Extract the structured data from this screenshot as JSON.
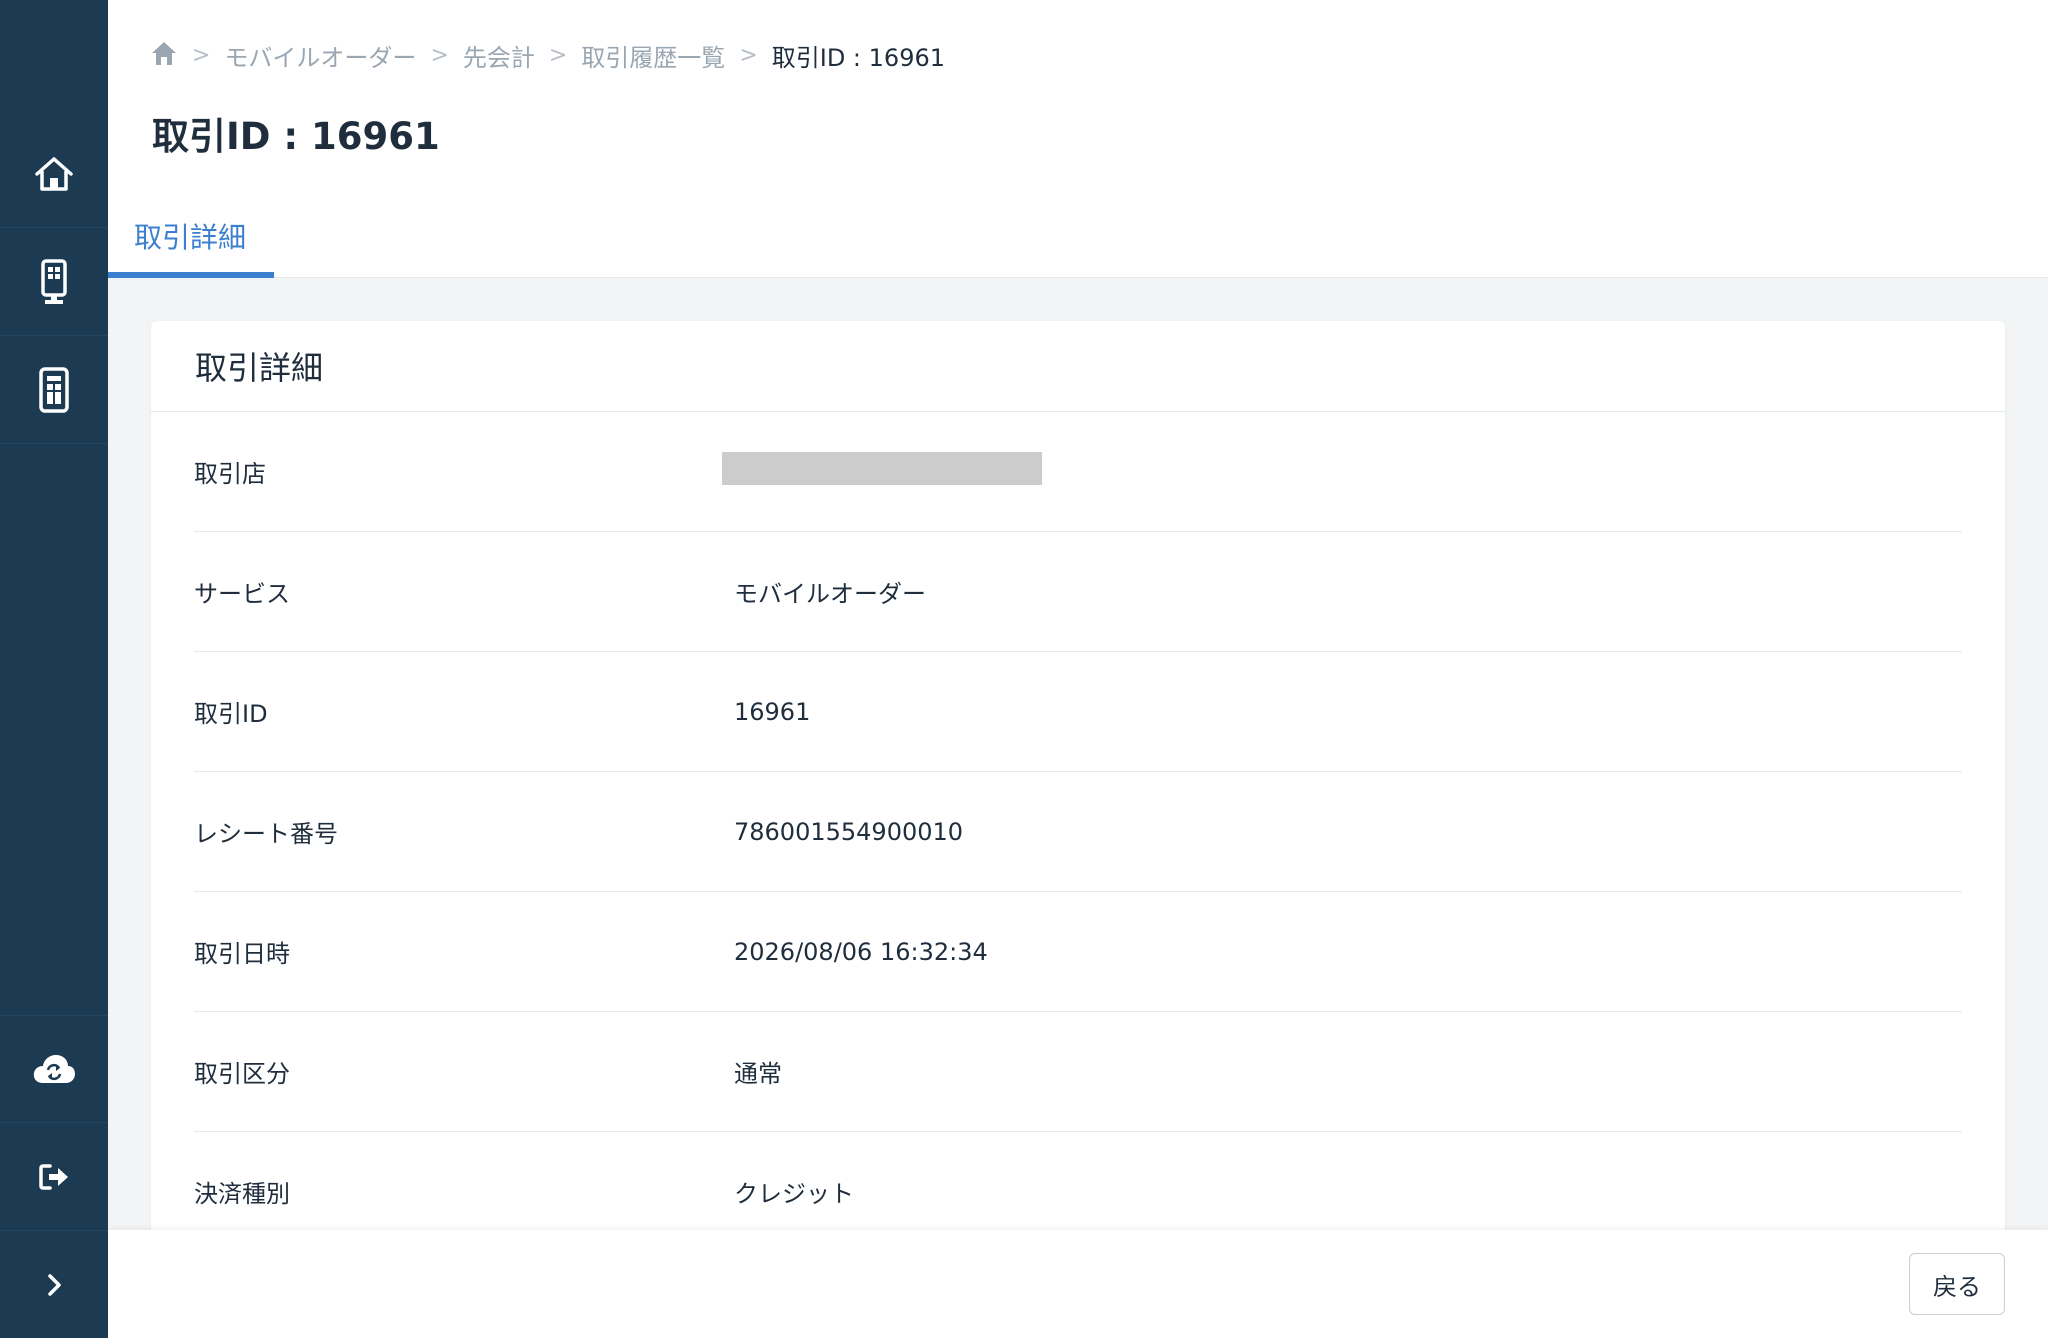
{
  "breadcrumb": {
    "items": [
      "モバイルオーダー",
      "先会計",
      "取引履歴一覧"
    ],
    "current": "取引ID : 16961"
  },
  "page_title": "取引ID : 16961",
  "tab": {
    "label": "取引詳細"
  },
  "card": {
    "title": "取引詳細",
    "rows": [
      {
        "label": "取引店",
        "value": ""
      },
      {
        "label": "サービス",
        "value": "モバイルオーダー"
      },
      {
        "label": "取引ID",
        "value": "16961"
      },
      {
        "label": "レシート番号",
        "value": "786001554900010"
      },
      {
        "label": "取引日時",
        "value": "2026/08/06 16:32:34"
      },
      {
        "label": "取引区分",
        "value": "通常"
      },
      {
        "label": "決済種別",
        "value": "クレジット"
      }
    ]
  },
  "footer": {
    "back_label": "戻る"
  },
  "sidebar": {
    "icons": [
      "home-icon",
      "kiosk-icon",
      "tablet-icon",
      "cloud-sync-icon",
      "logout-icon",
      "chevron-right-icon"
    ]
  },
  "colors": {
    "sidebar_bg": "#1c3a52",
    "accent": "#3b7fd0",
    "text": "#1f2d3d",
    "muted": "#9aa7b3"
  }
}
